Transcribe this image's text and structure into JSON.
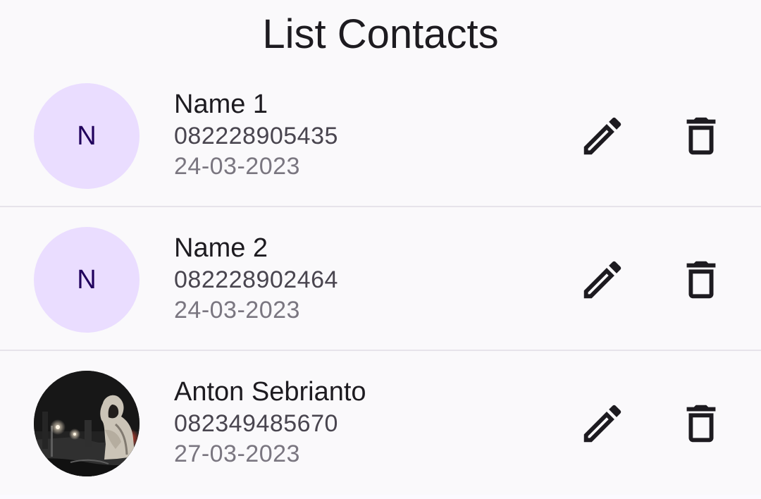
{
  "header": {
    "title": "List Contacts"
  },
  "contacts": [
    {
      "initial": "N",
      "name": "Name 1",
      "phone": "082228905435",
      "date": "24-03-2023",
      "avatar_type": "initial"
    },
    {
      "initial": "N",
      "name": "Name 2",
      "phone": "082228902464",
      "date": "24-03-2023",
      "avatar_type": "initial"
    },
    {
      "name": "Anton Sebrianto",
      "phone": "082349485670",
      "date": "27-03-2023",
      "avatar_type": "photo"
    }
  ],
  "icons": {
    "edit": "pencil-icon",
    "delete": "trash-icon"
  },
  "colors": {
    "avatar_background": "#eaddff",
    "avatar_text": "#21005d",
    "primary_text": "#1d1b20",
    "secondary_text": "#49454f",
    "tertiary_text": "#7a7680"
  }
}
